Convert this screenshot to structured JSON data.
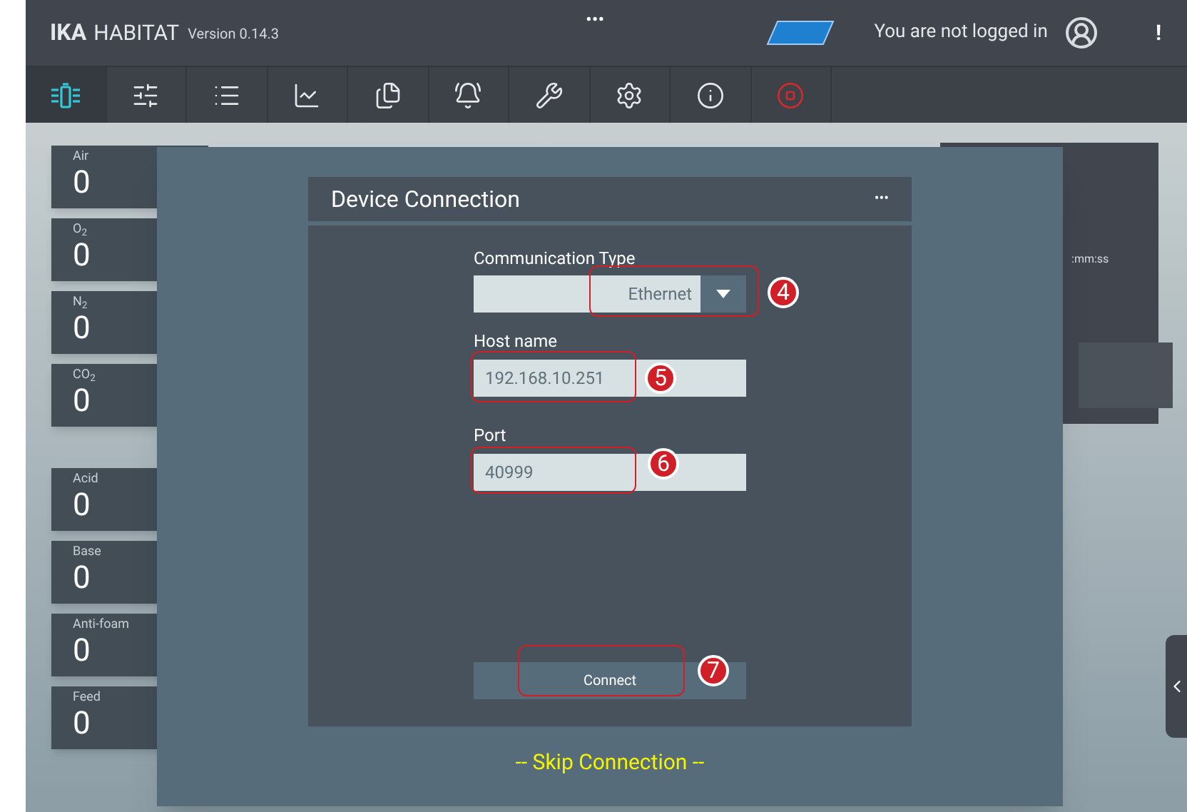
{
  "header": {
    "brand_bold": "IKA",
    "brand": "HABITAT",
    "version": "Version 0.14.3",
    "center_menu": "•••",
    "login_status": "You are not logged in",
    "alert": "!"
  },
  "toolbar": [
    {
      "selected": true
    },
    {
      "selected": false
    },
    {
      "selected": false
    },
    {
      "selected": false
    },
    {
      "selected": false
    },
    {
      "selected": false
    },
    {
      "selected": false
    },
    {
      "selected": false
    },
    {
      "selected": false
    },
    {
      "selected": false
    }
  ],
  "gas_tiles": [
    {
      "label": "Air",
      "value": "0"
    },
    {
      "label": "O$_{2}$",
      "value": "0"
    },
    {
      "label": "N$_{2}$",
      "value": "0"
    },
    {
      "label": "CO$_{2}$",
      "value": "0"
    }
  ],
  "pump_tiles": [
    {
      "label": "Acid",
      "value": "0"
    },
    {
      "label": "Base",
      "value": "0"
    },
    {
      "label": "Anti-foam",
      "value": "0"
    },
    {
      "label": "Feed",
      "value": "0"
    }
  ],
  "right_card": {
    "text": ":mm:ss"
  },
  "dialog": {
    "title": "Device Connection",
    "menu": "•••",
    "communication_type": {
      "label": "Communication Type",
      "value": "Ethernet"
    },
    "host_name": {
      "label": "Host name",
      "value": "192.168.10.251"
    },
    "port": {
      "label": "Port",
      "value": "40999"
    },
    "connect_button": "Connect",
    "skip_link": "-- Skip Connection --"
  },
  "annotations": [
    {
      "number": "4"
    },
    {
      "number": "5"
    },
    {
      "number": "6"
    },
    {
      "number": "7"
    }
  ]
}
